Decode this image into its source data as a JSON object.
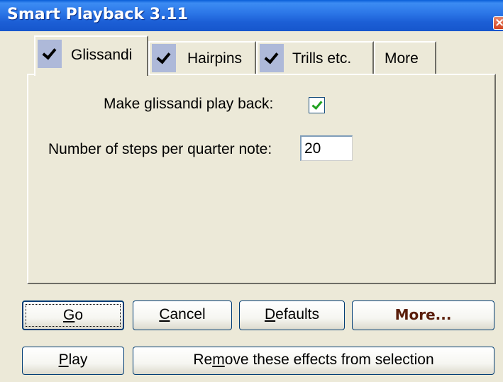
{
  "window": {
    "title": "Smart Playback 3.11",
    "close_glyph": "×"
  },
  "tabs": [
    {
      "label": "Glissandi",
      "checked": true,
      "active": true
    },
    {
      "label": "Hairpins",
      "checked": true,
      "active": false
    },
    {
      "label": "Trills etc.",
      "checked": true,
      "active": false
    },
    {
      "label": "More",
      "checked": false,
      "active": false
    }
  ],
  "glissandi": {
    "play_back_label": "Make glissandi play back:",
    "play_back_checked": true,
    "steps_label": "Number of steps per quarter note:",
    "steps_value": "20"
  },
  "buttons": {
    "go": {
      "mnemonic": "G",
      "rest": "o"
    },
    "cancel": {
      "mnemonic": "C",
      "rest": "ancel"
    },
    "defaults": {
      "mnemonic": "D",
      "rest": "efaults"
    },
    "more": {
      "label": "More..."
    },
    "play": {
      "mnemonic": "P",
      "rest": "lay"
    },
    "remove": {
      "prefix": "Re",
      "mnemonic": "m",
      "rest": "ove these effects from selection"
    }
  }
}
